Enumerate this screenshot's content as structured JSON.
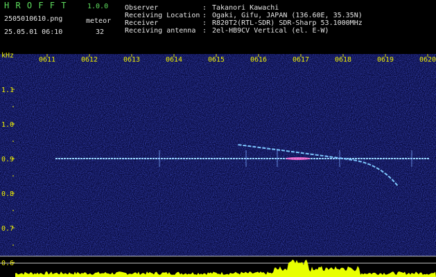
{
  "header": {
    "app_name": "H R O F F T",
    "app_version": "1.0.0",
    "file_name": "2505010610.png",
    "date_time": "25.05.01 06:10",
    "meteor_label": "meteor",
    "meteor_count": "32",
    "info_labels": [
      "Observer",
      "Receiving Location",
      "Receiver",
      "Receiving antenna"
    ],
    "info_values": [
      "Takanori Kawachi",
      "Ogaki, Gifu, JAPAN (136.60E, 35.35N)",
      "R820T2(RTL-SDR) SDR-Sharp 53.1000MHz",
      "2el-HB9CV Vertical (el. E-W)"
    ]
  },
  "chart_data": {
    "type": "heatmap",
    "title": "",
    "ylabel": "kHz",
    "x_ticks": [
      "0611",
      "0612",
      "0613",
      "0614",
      "0615",
      "0616",
      "0617",
      "0618",
      "0619",
      "0620"
    ],
    "y_ticks": [
      "1.1",
      "1.0",
      "0.9",
      "0.8",
      "0.7",
      "0.6"
    ],
    "y_tick_values": [
      1.1,
      1.0,
      0.9,
      0.8,
      0.7,
      0.6
    ],
    "ylim": [
      0.58,
      1.2
    ],
    "carrier_khz": 0.9,
    "meteor_trail": {
      "start_minute": "0616.5",
      "end_minute": "0619.3",
      "start_khz": 0.92,
      "end_khz": 0.82
    },
    "colors": {
      "background": "#06083a",
      "carrier": "#9ad8ff",
      "tick": "#f0f000",
      "spectrum": "#e8ff00"
    }
  }
}
